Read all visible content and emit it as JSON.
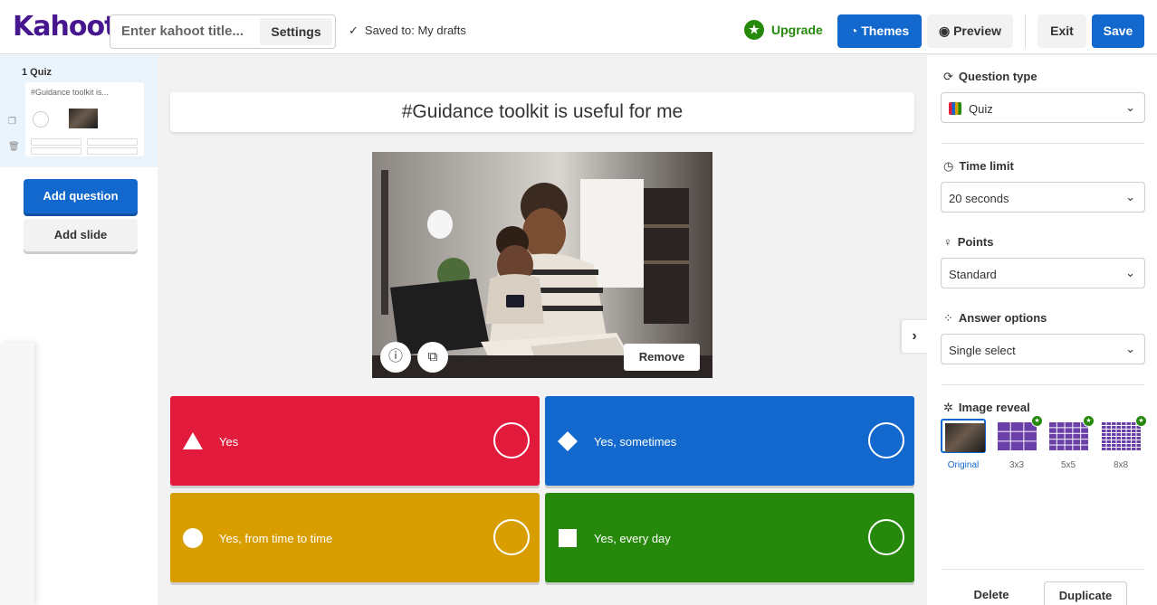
{
  "header": {
    "logo": "Kahoot!",
    "title_placeholder": "Enter kahoot title...",
    "settings_label": "Settings",
    "saved_status": "Saved to: My drafts",
    "upgrade_label": "Upgrade",
    "themes_label": "Themes",
    "preview_label": "Preview",
    "exit_label": "Exit",
    "save_label": "Save"
  },
  "sidebar": {
    "slides": [
      {
        "label": "1  Quiz",
        "thumb_title": "#Guidance toolkit is..."
      }
    ],
    "add_question_label": "Add question",
    "add_slide_label": "Add slide"
  },
  "question": {
    "text": "#Guidance toolkit is useful for me",
    "remove_label": "Remove"
  },
  "answers": [
    {
      "text": "Yes",
      "shape": "triangle",
      "color": "#e21b3c"
    },
    {
      "text": "Yes, sometimes",
      "shape": "diamond",
      "color": "#1368ce"
    },
    {
      "text": "Yes, from time to time",
      "shape": "circle",
      "color": "#d89e00"
    },
    {
      "text": "Yes, every day",
      "shape": "square",
      "color": "#26890c"
    }
  ],
  "panel": {
    "question_type": {
      "label": "Question type",
      "value": "Quiz"
    },
    "time_limit": {
      "label": "Time limit",
      "value": "20 seconds"
    },
    "points": {
      "label": "Points",
      "value": "Standard"
    },
    "answer_options": {
      "label": "Answer options",
      "value": "Single select"
    },
    "image_reveal": {
      "label": "Image reveal",
      "options": [
        "Original",
        "3x3",
        "5x5",
        "8x8"
      ],
      "selected": "Original"
    },
    "delete_label": "Delete",
    "duplicate_label": "Duplicate"
  },
  "colors": {
    "brand": "#46178f",
    "primary": "#1368ce",
    "upgrade": "#26890c"
  }
}
